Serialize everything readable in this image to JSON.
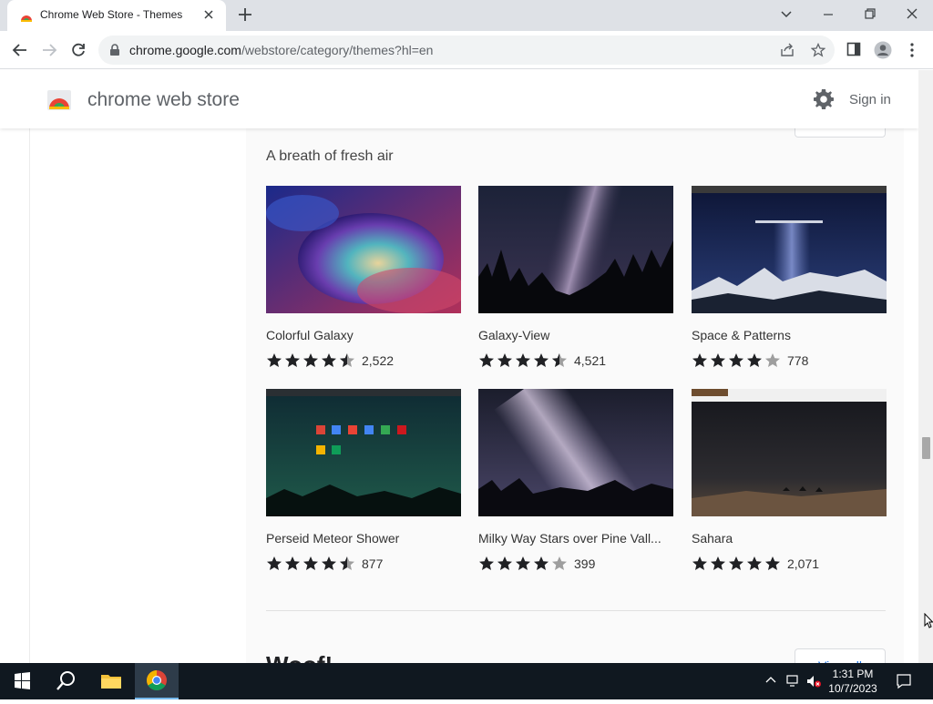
{
  "browser": {
    "tab_title": "Chrome Web Store - Themes",
    "url_host": "chrome.google.com",
    "url_path": "/webstore/category/themes?hl=en"
  },
  "store": {
    "title": "chrome web store",
    "sign_in": "Sign in"
  },
  "section": {
    "subtitle": "A breath of fresh air",
    "next_heading": "Woof!",
    "view_all": "View all"
  },
  "themes": [
    {
      "name": "Colorful Galaxy",
      "rating": 4.5,
      "count": "2,522"
    },
    {
      "name": "Galaxy-View",
      "rating": 4.5,
      "count": "4,521"
    },
    {
      "name": "Space & Patterns",
      "rating": 4,
      "count": "778"
    },
    {
      "name": "Perseid Meteor Shower",
      "rating": 4.5,
      "count": "877"
    },
    {
      "name": "Milky Way Stars over Pine Vall...",
      "rating": 4,
      "count": "399"
    },
    {
      "name": "Sahara",
      "rating": 5,
      "count": "2,071"
    }
  ],
  "taskbar": {
    "time": "1:31 PM",
    "date": "10/7/2023"
  },
  "colors": {
    "tabstrip": "#dee1e6",
    "taskbar": "#101820",
    "star": "#202124",
    "star_empty": "#9e9e9e",
    "link": "#1a73e8"
  }
}
